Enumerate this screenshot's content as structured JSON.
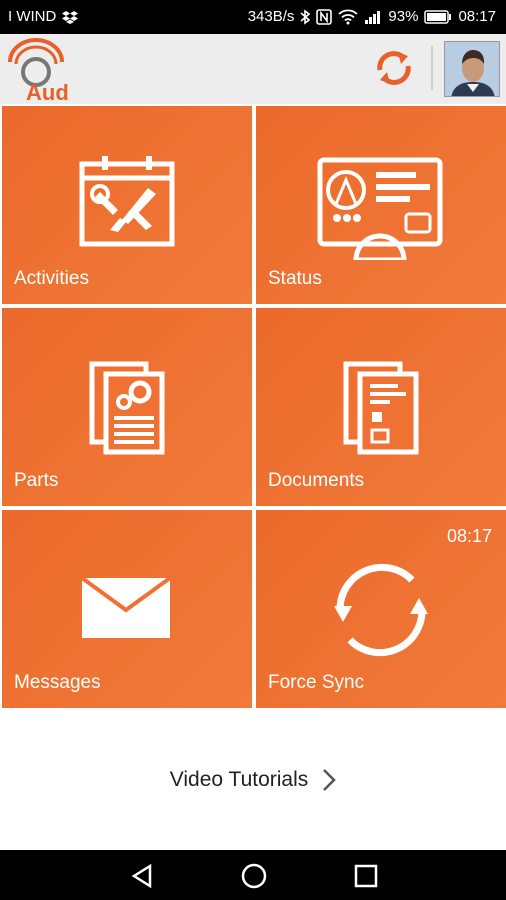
{
  "status_bar": {
    "carrier": "I WIND",
    "speed": "343B/s",
    "battery": "93%",
    "time": "08:17"
  },
  "app_bar": {
    "logo_text": "Aud"
  },
  "tiles": [
    {
      "label": "Activities",
      "icon": "tools-calendar-icon"
    },
    {
      "label": "Status",
      "icon": "dashboard-icon"
    },
    {
      "label": "Parts",
      "icon": "parts-documents-icon"
    },
    {
      "label": "Documents",
      "icon": "documents-icon"
    },
    {
      "label": "Messages",
      "icon": "envelope-icon"
    },
    {
      "label": "Force Sync",
      "icon": "sync-icon",
      "time": "08:17"
    }
  ],
  "video_tutorials": {
    "label": "Video Tutorials"
  },
  "colors": {
    "tile": "#ec6a2b",
    "accent": "#e8602a",
    "appbar": "#ededed"
  }
}
